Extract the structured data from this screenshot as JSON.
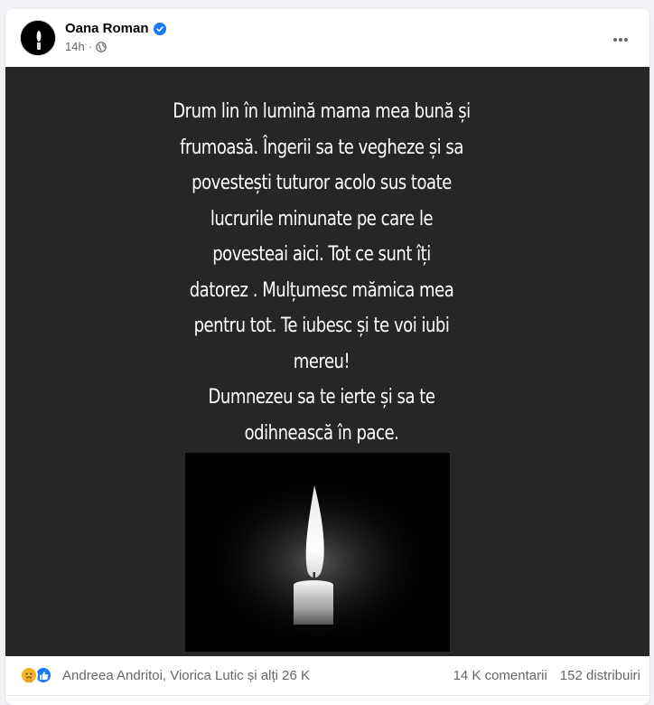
{
  "post": {
    "author": "Oana Roman",
    "time": "14h",
    "privacy_icon": "globe-icon",
    "verified_icon": "verified-badge-icon",
    "more_icon": "more-horizontal-icon"
  },
  "media": {
    "text": "Drum lin în lumină mama mea bună și\nfrumoasă. Îngerii sa te vegheze și sa\npovestești tuturor acolo sus toate\nlucrurile minunate pe care le\npovesteai aici. Tot ce sunt îți\ndatorez . Mulțumesc mămica mea\npentru tot. Te iubesc și te voi iubi\nmereu!\nDumnezeu sa te ierte și sa te\nodihnească în pace.",
    "image": "candle-image",
    "background": "#262626"
  },
  "footer": {
    "reactions": [
      "care-reaction-icon",
      "like-reaction-icon"
    ],
    "reactors": "Andreea Andritoi, Viorica Lutic și alți 26 K",
    "comments": "14 K comentarii",
    "shares": "152 distribuiri"
  },
  "colors": {
    "accent": "#1877f2",
    "secondary_text": "#65676b"
  }
}
